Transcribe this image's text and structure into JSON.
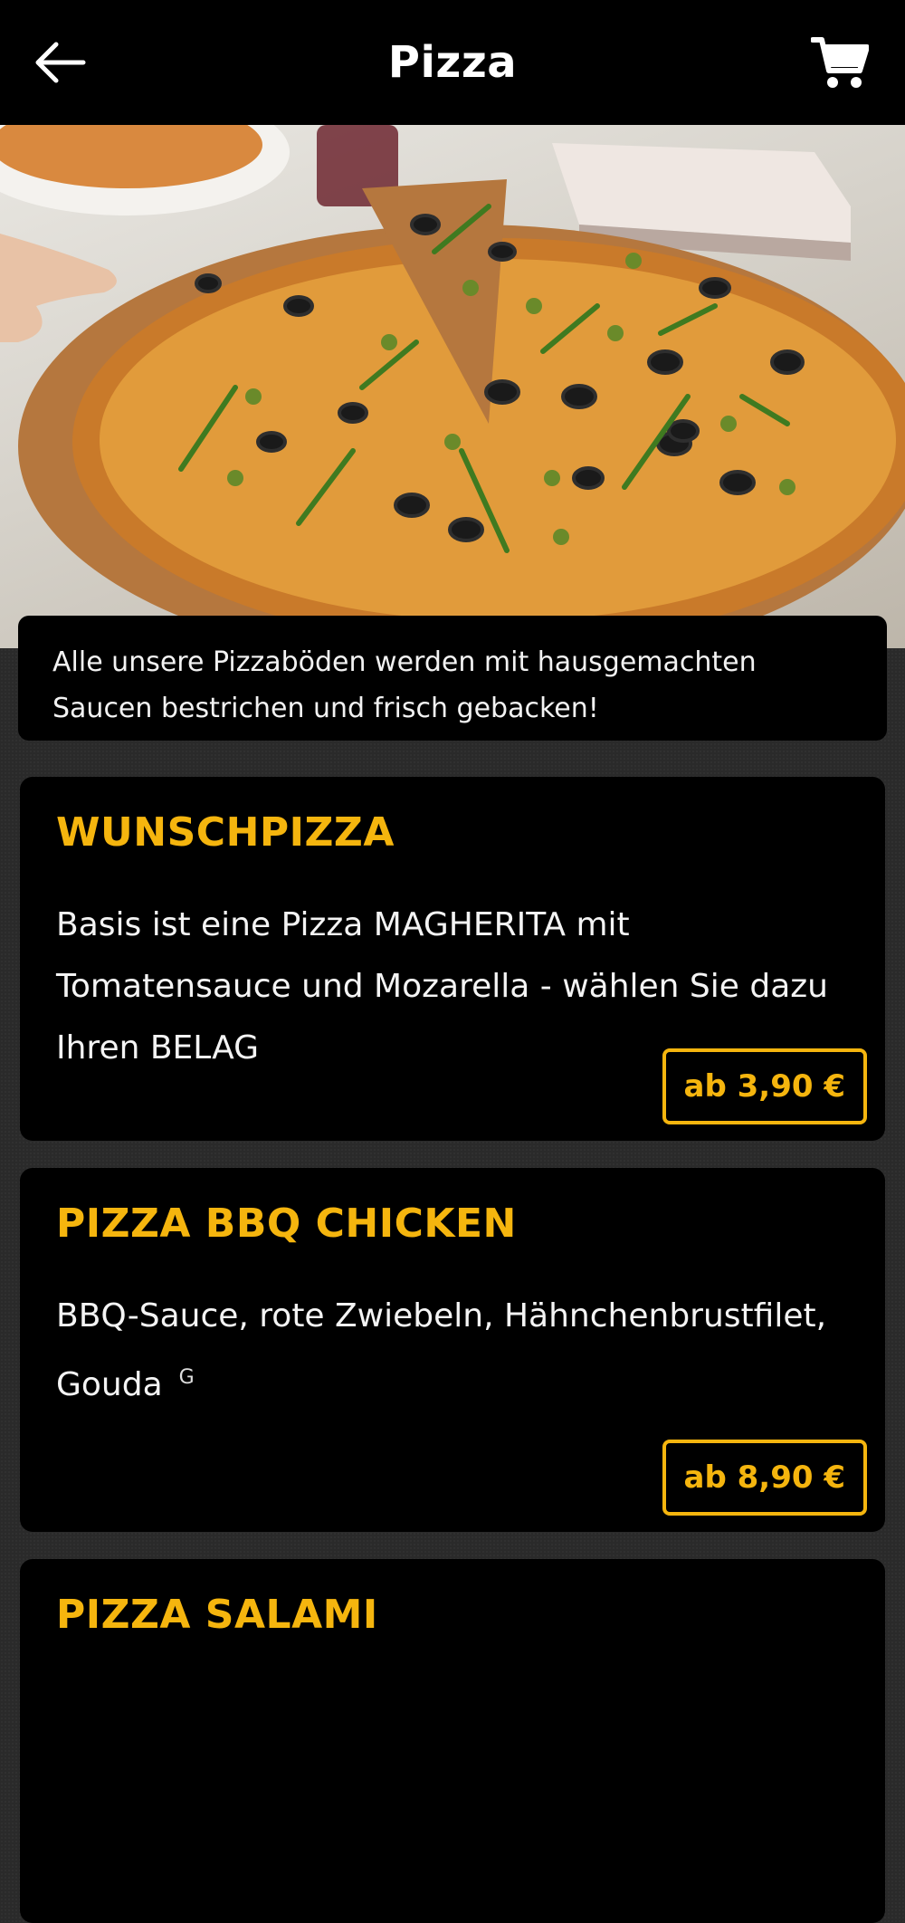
{
  "header": {
    "title": "Pizza",
    "back_icon": "arrow-left-icon",
    "cart_icon": "shopping-cart-icon"
  },
  "notice": {
    "text": "Alle unsere Pizzaböden werden mit hausgemachten Saucen bestrichen und frisch gebacken!"
  },
  "accent_color": "#f5b50e",
  "products": [
    {
      "name": "WUNSCHPIZZA",
      "description": "Basis ist eine Pizza MAGHERITA mit Tomatensauce und Mozarella - wählen Sie dazu Ihren BELAG",
      "allergen": "",
      "price": "ab 3,90 €"
    },
    {
      "name": "PIZZA BBQ CHICKEN",
      "description": "BBQ-Sauce, rote Zwiebeln, Hähnchenbrustfilet, Gouda",
      "allergen": "G",
      "price": "ab 8,90 €"
    },
    {
      "name": "PIZZA SALAMI"
    }
  ]
}
